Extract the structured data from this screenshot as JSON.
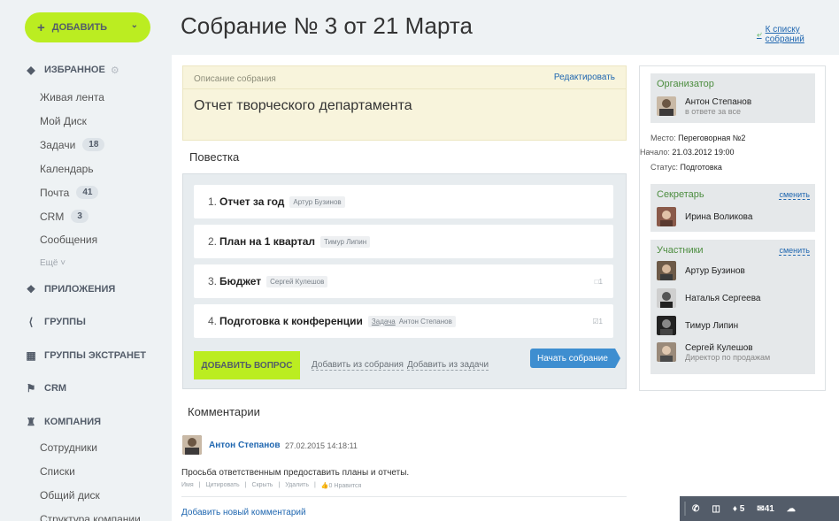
{
  "sidebar": {
    "add_button": "ДОБАВИТЬ",
    "favorites": "ИЗБРАННОЕ",
    "items": [
      {
        "label": "Живая лента"
      },
      {
        "label": "Мой Диск"
      },
      {
        "label": "Задачи",
        "count": "18"
      },
      {
        "label": "Календарь"
      },
      {
        "label": "Почта",
        "count": "41"
      },
      {
        "label": "CRM",
        "count": "3"
      },
      {
        "label": "Сообщения"
      }
    ],
    "more": "Ещё",
    "sections": [
      {
        "label": "ПРИЛОЖЕНИЯ",
        "icon": "apps-icon"
      },
      {
        "label": "ГРУППЫ",
        "icon": "share-icon"
      },
      {
        "label": "ГРУППЫ ЭКСТРАНЕТ",
        "icon": "extranet-icon"
      },
      {
        "label": "CRM",
        "icon": "flag-icon"
      },
      {
        "label": "КОМПАНИЯ",
        "icon": "tower-icon"
      }
    ],
    "company_items": [
      "Сотрудники",
      "Списки",
      "Общий диск",
      "Структура компании"
    ]
  },
  "header": {
    "title": "Собрание № 3 от 21 Марта",
    "back_link": "К списку собраний"
  },
  "description": {
    "label": "Описание собрания",
    "edit": "Редактировать",
    "text": "Отчет творческого департамента"
  },
  "agenda": {
    "title": "Повестка",
    "items": [
      {
        "num": "1.",
        "name": "Отчет за год",
        "tag_type": "",
        "person": "Артур Бузинов",
        "comments": ""
      },
      {
        "num": "2.",
        "name": "План на 1 квартал",
        "tag_type": "",
        "person": "Тимур Липин",
        "comments": ""
      },
      {
        "num": "3.",
        "name": "Бюджет",
        "tag_type": "",
        "person": "Сергей Кулешов",
        "comments": "1"
      },
      {
        "num": "4.",
        "name": "Подготовка к конференции",
        "tag_type": "Задача",
        "person": "Антон Степанов",
        "comments": "1"
      }
    ],
    "add_question": "ДОБАВИТЬ ВОПРОС",
    "add_from_meeting": "Добавить из собрания",
    "add_from_task": "Добавить из задачи",
    "start_meeting": "Начать собрание"
  },
  "comments": {
    "title": "Комментарии",
    "author": "Антон Степанов",
    "date": "27.02.2015 14:18:11",
    "text": "Просьба ответственным предоставить планы и отчеты.",
    "actions": [
      "Имя",
      "Цитировать",
      "Скрыть",
      "Удалить",
      "0 Нравится"
    ],
    "add_new": "Добавить новый комментарий"
  },
  "right": {
    "organizer_title": "Организатор",
    "organizer_name": "Антон Степанов",
    "organizer_role": "в ответе за все",
    "place_label": "Место:",
    "place_value": "Переговорная №2",
    "start_label": "Начало:",
    "start_value": "21.03.2012 19:00",
    "status_label": "Статус:",
    "status_value": "Подготовка",
    "secretary_title": "Секретарь",
    "change": "сменить",
    "secretary_name": "Ирина Воликова",
    "participants_title": "Участники",
    "participants": [
      {
        "name": "Артур Бузинов",
        "sub": ""
      },
      {
        "name": "Наталья Сергеева",
        "sub": ""
      },
      {
        "name": "Тимур Липин",
        "sub": ""
      },
      {
        "name": "Сергей Кулешов",
        "sub": "Директор по продажам"
      }
    ]
  },
  "bottom_bar": {
    "notifications": "5",
    "messages": "41"
  },
  "colors": {
    "accent_green": "#bbed21",
    "link_blue": "#2067b0",
    "button_blue": "#3e8ed0",
    "section_green": "#4c8d3f"
  }
}
